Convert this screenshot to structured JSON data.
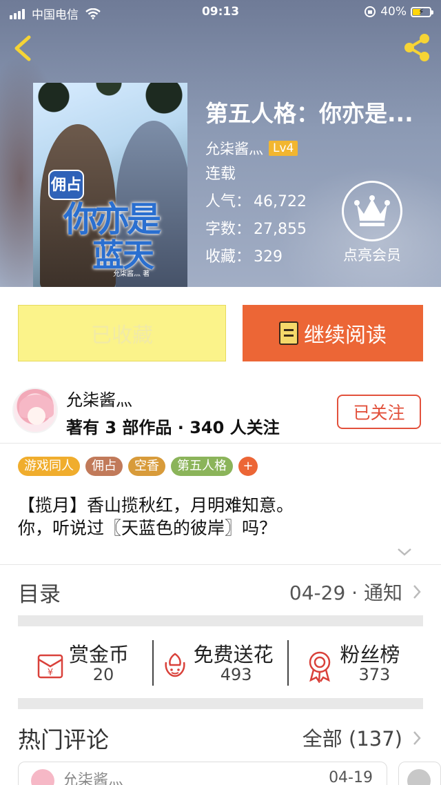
{
  "status_bar": {
    "carrier": "中国电信",
    "time": "09:13",
    "battery": "40%"
  },
  "book": {
    "title": "第五人格：你亦是...",
    "author": "允柒酱灬",
    "level": "Lv4",
    "status": "连载",
    "popularity_label": "人气：",
    "popularity": "46,722",
    "words_label": "字数：",
    "words": "27,855",
    "favorites_label": "收藏：",
    "favorites": "329",
    "cover": {
      "tag": "佣占",
      "title_line1": "你亦是",
      "title_line2": "蓝天",
      "author": "允柒酱灬 著"
    }
  },
  "vip": {
    "label": "点亮会员"
  },
  "actions": {
    "favorite_label": "已收藏",
    "read_label": "继续阅读"
  },
  "author_section": {
    "name": "允柒酱灬",
    "meta": "著有 3 部作品 · 340 人关注",
    "follow_label": "已关注"
  },
  "tags": [
    {
      "label": "游戏同人",
      "color": "#f0ad2d"
    },
    {
      "label": "佣占",
      "color": "#c17a5a"
    },
    {
      "label": "空香",
      "color": "#d89b3a"
    },
    {
      "label": "第五人格",
      "color": "#8bb45a"
    }
  ],
  "tag_plus": "+",
  "description": {
    "line1": "【揽月】香山揽秋红，月明难知意。",
    "line2": "你，听说过〖天蓝色的彼岸〗吗？"
  },
  "toc": {
    "label": "目录",
    "update": "04-29 · 通知"
  },
  "stats": [
    {
      "name": "赏金币",
      "value": "20",
      "icon": "red-envelope-icon"
    },
    {
      "name": "免费送花",
      "value": "493",
      "icon": "flower-icon"
    },
    {
      "name": "粉丝榜",
      "value": "373",
      "icon": "medal-icon"
    }
  ],
  "hot_comments": {
    "label": "热门评论",
    "all_label": "全部 (137)",
    "first": {
      "name": "允柒酱灬",
      "date": "04-19"
    }
  },
  "colors": {
    "accent": "#ec6636",
    "favorite_bg": "#fbf38a",
    "follow": "#e2503b",
    "level_badge": "#f2b630"
  }
}
